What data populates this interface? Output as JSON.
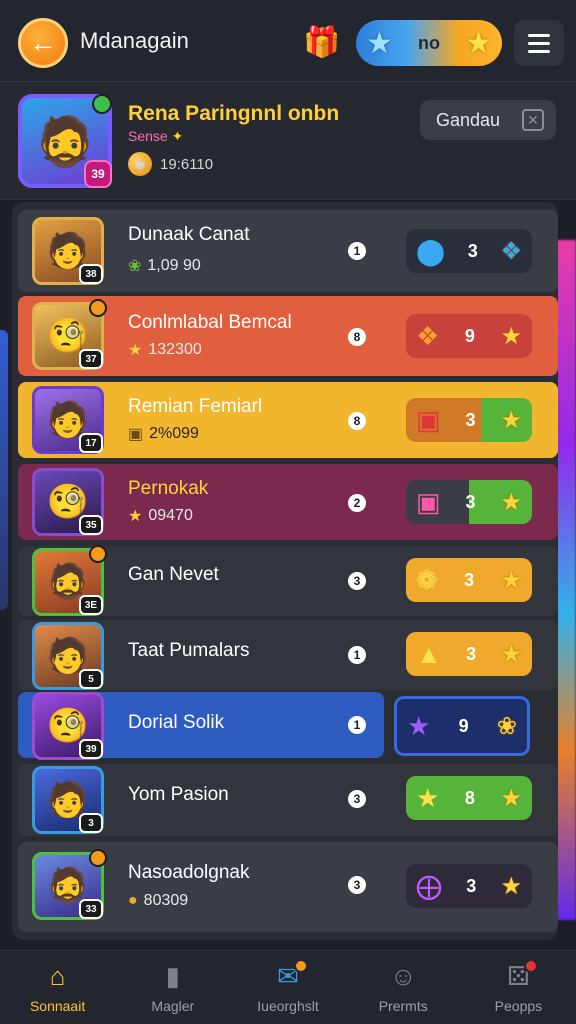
{
  "header": {
    "back_icon": "arrow-left-icon",
    "title": "Mdanagain",
    "gift_icon": "gift-icon",
    "currency_value": "no",
    "menu_icon": "hamburger-menu-icon"
  },
  "profile": {
    "name": "Rena Paringnnl onbn",
    "subtitle": "Sense",
    "level": "39",
    "coins": "19:6110",
    "button_label": "Gandau"
  },
  "rows": [
    {
      "name": "Dunaak Canat",
      "score": "1,09 90",
      "rank": "1",
      "reward_count": "3",
      "color": "#3a3d45",
      "reward_bg": "#2a2e3a",
      "reward_icon": "blue-orb-icon",
      "avatar_lv": "38"
    },
    {
      "name": "Conlmlabal Bemcal",
      "score": "132300",
      "rank": "8",
      "reward_count": "9",
      "color": "#e05f3e",
      "reward_bg": "#c8413a",
      "reward_icon": "fire-card-icon",
      "avatar_lv": "37"
    },
    {
      "name": "Remian Femiarl",
      "score": "2%099",
      "rank": "8",
      "reward_count": "3",
      "color": "#f1b52e",
      "reward_bg": "#d07a28",
      "reward_icon": "red-chest-icon",
      "avatar_lv": "17"
    },
    {
      "name": "Pernokak",
      "score": "09470",
      "rank": "2",
      "reward_count": "3",
      "color": "#7b2a4e",
      "reward_bg": "#3a3d45",
      "reward_icon": "pink-card-icon",
      "avatar_lv": "35"
    },
    {
      "name": "Gan Nevet",
      "score": "",
      "rank": "3",
      "reward_count": "3",
      "color": "#32353c",
      "reward_bg": "#f0a92a",
      "reward_icon": "gold-medal-icon",
      "avatar_lv": "3E"
    },
    {
      "name": "Taat Pumalars",
      "score": "",
      "rank": "1",
      "reward_count": "3",
      "color": "#32353c",
      "reward_bg": "#f0a92a",
      "reward_icon": "gold-bag-icon",
      "avatar_lv": "5"
    },
    {
      "name": "Dorial Solik",
      "score": "",
      "rank": "1",
      "reward_count": "9",
      "color": "#2d5bbf",
      "reward_bg": "#1d2f6a",
      "reward_icon": "purple-star-icon",
      "avatar_lv": "39"
    },
    {
      "name": "Yom Pasion",
      "score": "",
      "rank": "3",
      "reward_count": "8",
      "color": "#32353c",
      "reward_bg": "#56b43a",
      "reward_icon": "gold-star-icon",
      "avatar_lv": "3"
    },
    {
      "name": "Nasoadolgnak",
      "score": "80309",
      "rank": "3",
      "reward_count": "3",
      "color": "#3a3d45",
      "reward_bg": "#2e2a3a",
      "reward_icon": "purple-orb-icon",
      "avatar_lv": "33"
    }
  ],
  "nav": [
    {
      "label": "Sonnaait",
      "icon": "home-icon"
    },
    {
      "label": "Magler",
      "icon": "cards-icon"
    },
    {
      "label": "Iueorghslt",
      "icon": "chat-icon"
    },
    {
      "label": "Prermts",
      "icon": "people-icon"
    },
    {
      "label": "Peopps",
      "icon": "dice-icon"
    }
  ]
}
